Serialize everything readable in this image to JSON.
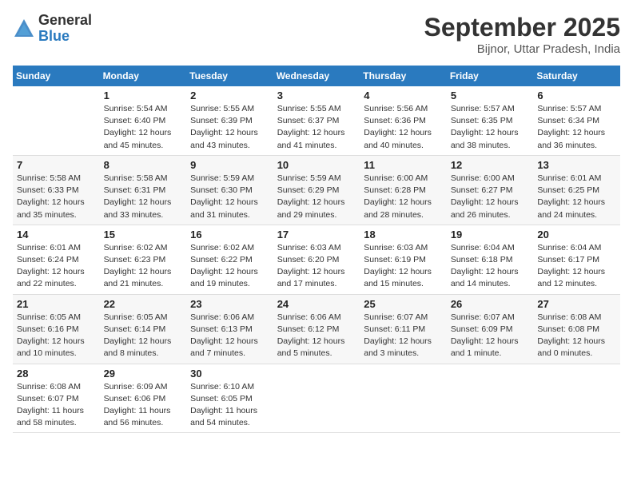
{
  "header": {
    "logo_general": "General",
    "logo_blue": "Blue",
    "month_title": "September 2025",
    "location": "Bijnor, Uttar Pradesh, India"
  },
  "days_of_week": [
    "Sunday",
    "Monday",
    "Tuesday",
    "Wednesday",
    "Thursday",
    "Friday",
    "Saturday"
  ],
  "weeks": [
    [
      {
        "num": "",
        "info": ""
      },
      {
        "num": "1",
        "info": "Sunrise: 5:54 AM\nSunset: 6:40 PM\nDaylight: 12 hours\nand 45 minutes."
      },
      {
        "num": "2",
        "info": "Sunrise: 5:55 AM\nSunset: 6:39 PM\nDaylight: 12 hours\nand 43 minutes."
      },
      {
        "num": "3",
        "info": "Sunrise: 5:55 AM\nSunset: 6:37 PM\nDaylight: 12 hours\nand 41 minutes."
      },
      {
        "num": "4",
        "info": "Sunrise: 5:56 AM\nSunset: 6:36 PM\nDaylight: 12 hours\nand 40 minutes."
      },
      {
        "num": "5",
        "info": "Sunrise: 5:57 AM\nSunset: 6:35 PM\nDaylight: 12 hours\nand 38 minutes."
      },
      {
        "num": "6",
        "info": "Sunrise: 5:57 AM\nSunset: 6:34 PM\nDaylight: 12 hours\nand 36 minutes."
      }
    ],
    [
      {
        "num": "7",
        "info": "Sunrise: 5:58 AM\nSunset: 6:33 PM\nDaylight: 12 hours\nand 35 minutes."
      },
      {
        "num": "8",
        "info": "Sunrise: 5:58 AM\nSunset: 6:31 PM\nDaylight: 12 hours\nand 33 minutes."
      },
      {
        "num": "9",
        "info": "Sunrise: 5:59 AM\nSunset: 6:30 PM\nDaylight: 12 hours\nand 31 minutes."
      },
      {
        "num": "10",
        "info": "Sunrise: 5:59 AM\nSunset: 6:29 PM\nDaylight: 12 hours\nand 29 minutes."
      },
      {
        "num": "11",
        "info": "Sunrise: 6:00 AM\nSunset: 6:28 PM\nDaylight: 12 hours\nand 28 minutes."
      },
      {
        "num": "12",
        "info": "Sunrise: 6:00 AM\nSunset: 6:27 PM\nDaylight: 12 hours\nand 26 minutes."
      },
      {
        "num": "13",
        "info": "Sunrise: 6:01 AM\nSunset: 6:25 PM\nDaylight: 12 hours\nand 24 minutes."
      }
    ],
    [
      {
        "num": "14",
        "info": "Sunrise: 6:01 AM\nSunset: 6:24 PM\nDaylight: 12 hours\nand 22 minutes."
      },
      {
        "num": "15",
        "info": "Sunrise: 6:02 AM\nSunset: 6:23 PM\nDaylight: 12 hours\nand 21 minutes."
      },
      {
        "num": "16",
        "info": "Sunrise: 6:02 AM\nSunset: 6:22 PM\nDaylight: 12 hours\nand 19 minutes."
      },
      {
        "num": "17",
        "info": "Sunrise: 6:03 AM\nSunset: 6:20 PM\nDaylight: 12 hours\nand 17 minutes."
      },
      {
        "num": "18",
        "info": "Sunrise: 6:03 AM\nSunset: 6:19 PM\nDaylight: 12 hours\nand 15 minutes."
      },
      {
        "num": "19",
        "info": "Sunrise: 6:04 AM\nSunset: 6:18 PM\nDaylight: 12 hours\nand 14 minutes."
      },
      {
        "num": "20",
        "info": "Sunrise: 6:04 AM\nSunset: 6:17 PM\nDaylight: 12 hours\nand 12 minutes."
      }
    ],
    [
      {
        "num": "21",
        "info": "Sunrise: 6:05 AM\nSunset: 6:16 PM\nDaylight: 12 hours\nand 10 minutes."
      },
      {
        "num": "22",
        "info": "Sunrise: 6:05 AM\nSunset: 6:14 PM\nDaylight: 12 hours\nand 8 minutes."
      },
      {
        "num": "23",
        "info": "Sunrise: 6:06 AM\nSunset: 6:13 PM\nDaylight: 12 hours\nand 7 minutes."
      },
      {
        "num": "24",
        "info": "Sunrise: 6:06 AM\nSunset: 6:12 PM\nDaylight: 12 hours\nand 5 minutes."
      },
      {
        "num": "25",
        "info": "Sunrise: 6:07 AM\nSunset: 6:11 PM\nDaylight: 12 hours\nand 3 minutes."
      },
      {
        "num": "26",
        "info": "Sunrise: 6:07 AM\nSunset: 6:09 PM\nDaylight: 12 hours\nand 1 minute."
      },
      {
        "num": "27",
        "info": "Sunrise: 6:08 AM\nSunset: 6:08 PM\nDaylight: 12 hours\nand 0 minutes."
      }
    ],
    [
      {
        "num": "28",
        "info": "Sunrise: 6:08 AM\nSunset: 6:07 PM\nDaylight: 11 hours\nand 58 minutes."
      },
      {
        "num": "29",
        "info": "Sunrise: 6:09 AM\nSunset: 6:06 PM\nDaylight: 11 hours\nand 56 minutes."
      },
      {
        "num": "30",
        "info": "Sunrise: 6:10 AM\nSunset: 6:05 PM\nDaylight: 11 hours\nand 54 minutes."
      },
      {
        "num": "",
        "info": ""
      },
      {
        "num": "",
        "info": ""
      },
      {
        "num": "",
        "info": ""
      },
      {
        "num": "",
        "info": ""
      }
    ]
  ]
}
